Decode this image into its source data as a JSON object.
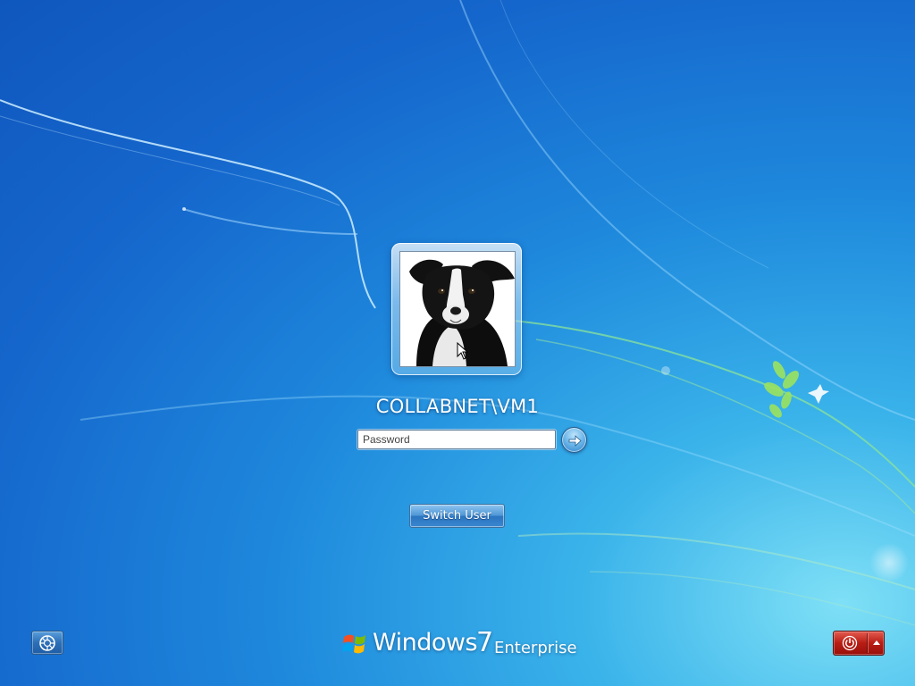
{
  "screen": "Windows 7 logon screen",
  "user": {
    "account_name": "COLLABNET\\VM1",
    "picture": "border-collie-dog-photo"
  },
  "password": {
    "value": "",
    "placeholder": "Password"
  },
  "submit": {
    "icon": "arrow-right-icon"
  },
  "switch_user": {
    "label": "Switch User"
  },
  "ease_of_access": {
    "icon": "ease-of-access-icon"
  },
  "branding": {
    "logo": "windows-flag-icon",
    "product": "Windows",
    "version": "7",
    "edition": "Enterprise"
  },
  "shutdown": {
    "icon": "power-icon",
    "menu_icon": "triangle-up-icon"
  },
  "colors": {
    "background_blue": "#1566cc",
    "background_highlight": "#7fe0f6",
    "button_blue": "#4f97d6",
    "shutdown_red": "#b81d14",
    "text": "#ffffff"
  }
}
